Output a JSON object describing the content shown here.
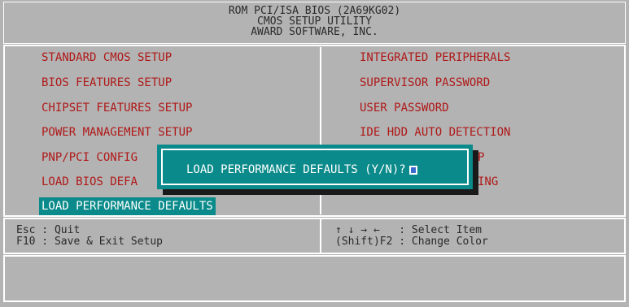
{
  "header": {
    "line1": "ROM PCI/ISA BIOS (2A69KG02)",
    "line2": "CMOS SETUP UTILITY",
    "line3": "AWARD SOFTWARE, INC."
  },
  "menu": {
    "left": [
      "STANDARD CMOS SETUP",
      "BIOS FEATURES SETUP",
      "CHIPSET FEATURES SETUP",
      "POWER MANAGEMENT SETUP",
      "PNP/PCI CONFIG",
      "LOAD BIOS DEFA",
      "LOAD PERFORMANCE DEFAULTS"
    ],
    "right": [
      "INTEGRATED PERIPHERALS",
      "SUPERVISOR PASSWORD",
      "USER PASSWORD",
      "IDE HDD AUTO DETECTION",
      "P",
      "ING"
    ]
  },
  "help": {
    "esc": "Esc : Quit",
    "f10": "F10 : Save & Exit Setup",
    "arrows": "↑ ↓ → ←   : Select Item",
    "shift_f2": "(Shift)F2 : Change Color"
  },
  "dialog": {
    "prompt": "LOAD PERFORMANCE DEFAULTS (Y/N)?"
  },
  "colors": {
    "background": "#b3b3b3",
    "menu_text": "#b01818",
    "highlight": "#0a8a8a",
    "cursor": "#3a6ad0"
  }
}
